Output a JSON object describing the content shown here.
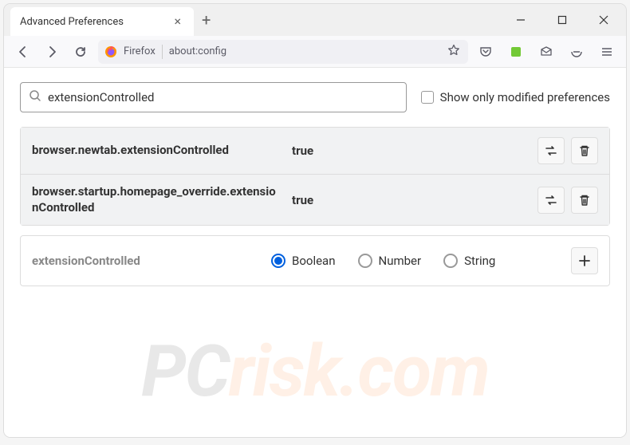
{
  "window": {
    "tab_title": "Advanced Preferences"
  },
  "urlbar": {
    "browser_label": "Firefox",
    "url": "about:config"
  },
  "search": {
    "value": "extensionControlled",
    "checkbox_label": "Show only modified preferences"
  },
  "prefs": [
    {
      "name": "browser.newtab.extensionControlled",
      "value": "true"
    },
    {
      "name": "browser.startup.homepage_override.extensionControlled",
      "value": "true"
    }
  ],
  "new_pref": {
    "name": "extensionControlled",
    "types": [
      "Boolean",
      "Number",
      "String"
    ],
    "selected": "Boolean"
  },
  "watermark": {
    "pc": "PC",
    "rest": "risk.com"
  }
}
